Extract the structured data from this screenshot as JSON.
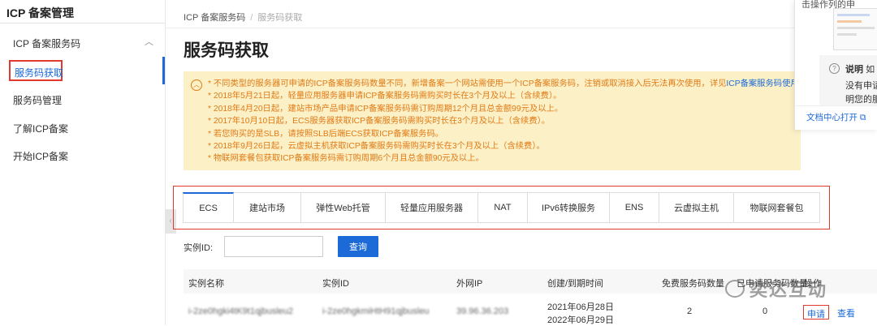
{
  "sidebar": {
    "title": "ICP 备案管理",
    "group": "ICP 备案服务码",
    "items": [
      {
        "label": "服务码获取",
        "active": true
      },
      {
        "label": "服务码管理"
      },
      {
        "label": "了解ICP备案"
      },
      {
        "label": "开始ICP备案"
      }
    ]
  },
  "breadcrumb": {
    "parent": "ICP 备案服务码",
    "separator": "/",
    "current": "服务码获取"
  },
  "page_title": "服务码获取",
  "notice": {
    "lines": [
      "* 不同类型的服务器可申请的ICP备案服务码数量不同，新增备案一个网站需使用一个ICP备案服务码，注销或取消接入后无法再次使用，详见",
      "* 2018年5月21日起，轻量应用服务器申请ICP备案服务码需购买时长在3个月及以上（含续费）。",
      "* 2018年4月20日起，建站市场产品申请ICP备案服务码需订购周期12个月且总金额99元及以上。",
      "* 2017年10月10日起，ECS服务器获取ICP备案服务码需购买时长在3个月及以上（含续费）。",
      "* 若您购买的是SLB，请按照SLB后端ECS获取ICP备案服务码。",
      "* 2018年9月26日起，云虚拟主机获取ICP备案服务码需购买时长在3个月及以上（含续费）。",
      "* 物联网套餐包获取ICP备案服务码需订购周期6个月且总金额90元及以上。"
    ],
    "link": "ICP备案服务码使用"
  },
  "tabs": [
    "ECS",
    "建站市场",
    "弹性Web托管",
    "轻量应用服务器",
    "NAT",
    "IPv6转换服务",
    "ENS",
    "云虚拟主机",
    "物联网套餐包"
  ],
  "filter": {
    "label": "实例ID:",
    "value": "",
    "button": "查询"
  },
  "table": {
    "headers": [
      "实例名称",
      "实例ID",
      "外网IP",
      "创建/到期时间",
      "免费服务码数量",
      "已申请服务码数量",
      "操作"
    ],
    "rows": [
      {
        "name": "i-2ze0hgki4tK9t1qjbusleu2",
        "id": "i-2ze0hgkmiHtH91qjbusleu",
        "ip": "39.96.36.203",
        "created": "2021年06月28日",
        "expires": "2022年06月29日",
        "free_count": "2",
        "used_count": "0",
        "actions": [
          "申请",
          "查看"
        ]
      }
    ]
  },
  "doc_panel": {
    "top_text": "击操作列的申",
    "note_title": "说明",
    "note_title_tail": "如",
    "note_lines": [
      "没有申请",
      "明您的服"
    ],
    "open_link": "文档中心打开"
  },
  "watermark": "奕达互动"
}
